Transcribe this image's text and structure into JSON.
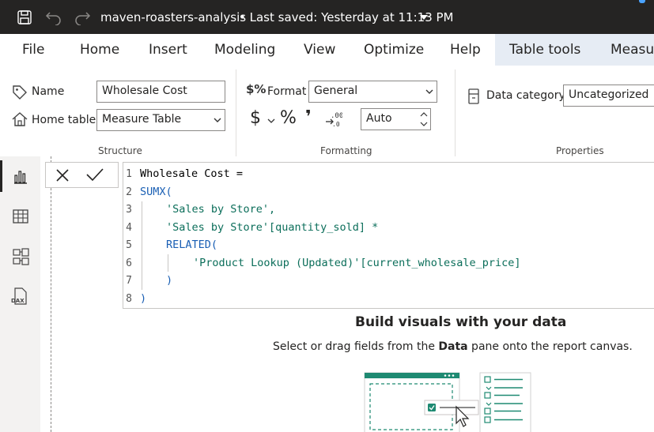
{
  "titlebar": {
    "file_name": "maven-roasters-analysis",
    "saved_status": "• Last saved: Yesterday at 11:13 PM",
    "icons": [
      "save-icon",
      "undo-icon",
      "redo-icon",
      "dropdown-icon"
    ]
  },
  "tabs": {
    "file": "File",
    "home": "Home",
    "insert": "Insert",
    "modeling": "Modeling",
    "view": "View",
    "optimize": "Optimize",
    "help": "Help",
    "table_tools": "Table tools",
    "measure_tools": "Measure"
  },
  "structure": {
    "name_label": "Name",
    "name_value": "Wholesale Cost",
    "home_table_label": "Home table",
    "home_table_value": "Measure Table",
    "group_label": "Structure"
  },
  "formatting": {
    "format_label": "Format",
    "format_value": "General",
    "currency_symbol": "$",
    "percent_symbol": "%",
    "comma_symbol": "❜",
    "decimals_value": "Auto",
    "group_label": "Formatting"
  },
  "properties": {
    "data_category_label": "Data category",
    "data_category_value": "Uncategorized",
    "group_label": "Properties"
  },
  "formula": {
    "lines": [
      {
        "num": "1",
        "text": "Wholesale Cost ="
      },
      {
        "num": "2",
        "text": "SUMX("
      },
      {
        "num": "3",
        "text": "'Sales by Store',"
      },
      {
        "num": "4",
        "text": "'Sales by Store'[quantity_sold] *"
      },
      {
        "num": "5",
        "text": "RELATED("
      },
      {
        "num": "6",
        "text": "'Product Lookup (Updated)'[current_wholesale_price]"
      },
      {
        "num": "7",
        "text": ")"
      },
      {
        "num": "8",
        "text": ")"
      }
    ]
  },
  "canvas": {
    "empty_title": "Build visuals with your data",
    "empty_sub_pre": "Select or drag fields from the ",
    "empty_sub_bold": "Data",
    "empty_sub_post": " pane onto the report canvas."
  },
  "colors": {
    "titlebar": "#252423",
    "accent_teal": "#1e8a72",
    "dax_keyword": "#1a5fb4",
    "dax_string": "#0b6e5a"
  }
}
